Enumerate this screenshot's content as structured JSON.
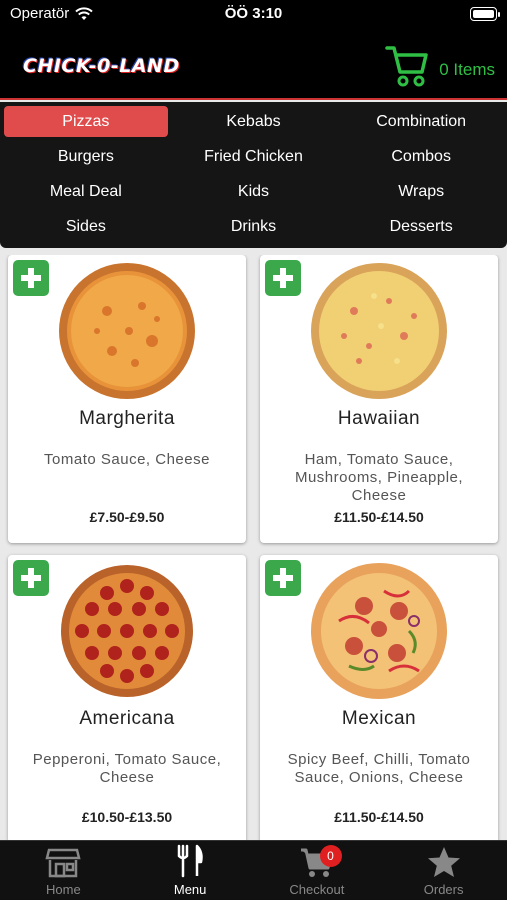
{
  "status_bar": {
    "carrier": "Operatör",
    "time": "ÖÖ 3:10"
  },
  "header": {
    "logo_text": "CHICK-0-LAND",
    "cart_label": "0 Items",
    "accent": "#2fbf45"
  },
  "categories": [
    {
      "label": "Pizzas",
      "active": true
    },
    {
      "label": "Kebabs"
    },
    {
      "label": "Combination"
    },
    {
      "label": "Burgers"
    },
    {
      "label": "Fried Chicken"
    },
    {
      "label": "Combos"
    },
    {
      "label": "Meal Deal"
    },
    {
      "label": "Kids"
    },
    {
      "label": "Wraps"
    },
    {
      "label": "Sides"
    },
    {
      "label": "Drinks"
    },
    {
      "label": "Desserts"
    }
  ],
  "products": [
    {
      "name": "Margherita",
      "description": "Tomato Sauce, Cheese",
      "price": "£7.50-£9.50",
      "topping": "cheese"
    },
    {
      "name": "Hawaiian",
      "description": "Ham, Tomato Sauce, Mushrooms, Pineapple, Cheese",
      "price": "£11.50-£14.50",
      "topping": "hawaiian"
    },
    {
      "name": "Americana",
      "description": "Pepperoni, Tomato Sauce, Cheese",
      "price": "£10.50-£13.50",
      "topping": "pepperoni"
    },
    {
      "name": "Mexican",
      "description": "Spicy Beef, Chilli, Tomato Sauce, Onions, Cheese",
      "price": "£11.50-£14.50",
      "topping": "mexican"
    }
  ],
  "tabbar": {
    "home": "Home",
    "menu": "Menu",
    "checkout": "Checkout",
    "checkout_badge": "0",
    "orders": "Orders"
  }
}
